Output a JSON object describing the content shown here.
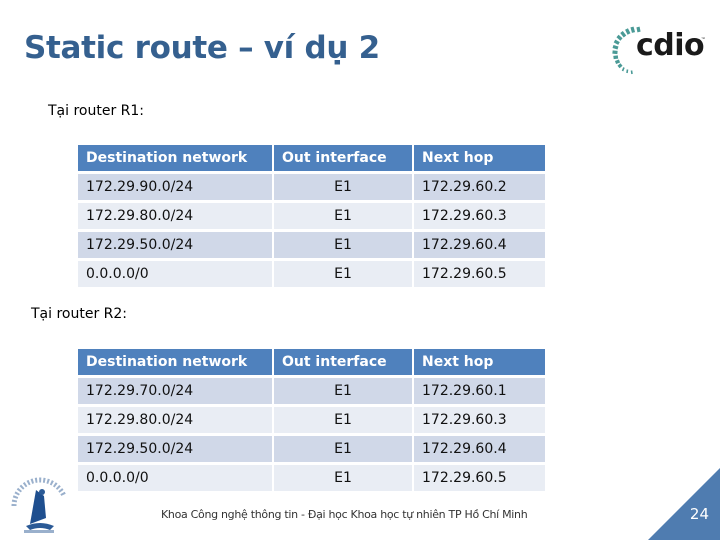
{
  "slide": {
    "title": "Static route – ví dụ 2",
    "logo_text": "cdio",
    "logo_tm": "™",
    "page_number": "24",
    "footer": "Khoa Công nghệ thông tin - Đại học Khoa học tự nhiên TP Hồ Chí Minh"
  },
  "colors": {
    "title": "#35608f",
    "table_header": "#4f81bd",
    "row_odd": "#d0d8e8",
    "row_even": "#e9edf4",
    "corner": "#4f7cb0"
  },
  "tables": [
    {
      "label": "Tại router R1:",
      "headers": [
        "Destination network",
        "Out interface",
        "Next hop"
      ],
      "rows": [
        [
          "172.29.90.0/24",
          "E1",
          "172.29.60.2"
        ],
        [
          "172.29.80.0/24",
          "E1",
          "172.29.60.3"
        ],
        [
          "172.29.50.0/24",
          "E1",
          "172.29.60.4"
        ],
        [
          "0.0.0.0/0",
          "E1",
          "172.29.60.5"
        ]
      ]
    },
    {
      "label": "Tại router R2:",
      "headers": [
        "Destination network",
        "Out interface",
        "Next hop"
      ],
      "rows": [
        [
          "172.29.70.0/24",
          "E1",
          "172.29.60.1"
        ],
        [
          "172.29.80.0/24",
          "E1",
          "172.29.60.3"
        ],
        [
          "172.29.50.0/24",
          "E1",
          "172.29.60.4"
        ],
        [
          "0.0.0.0/0",
          "E1",
          "172.29.60.5"
        ]
      ]
    }
  ]
}
